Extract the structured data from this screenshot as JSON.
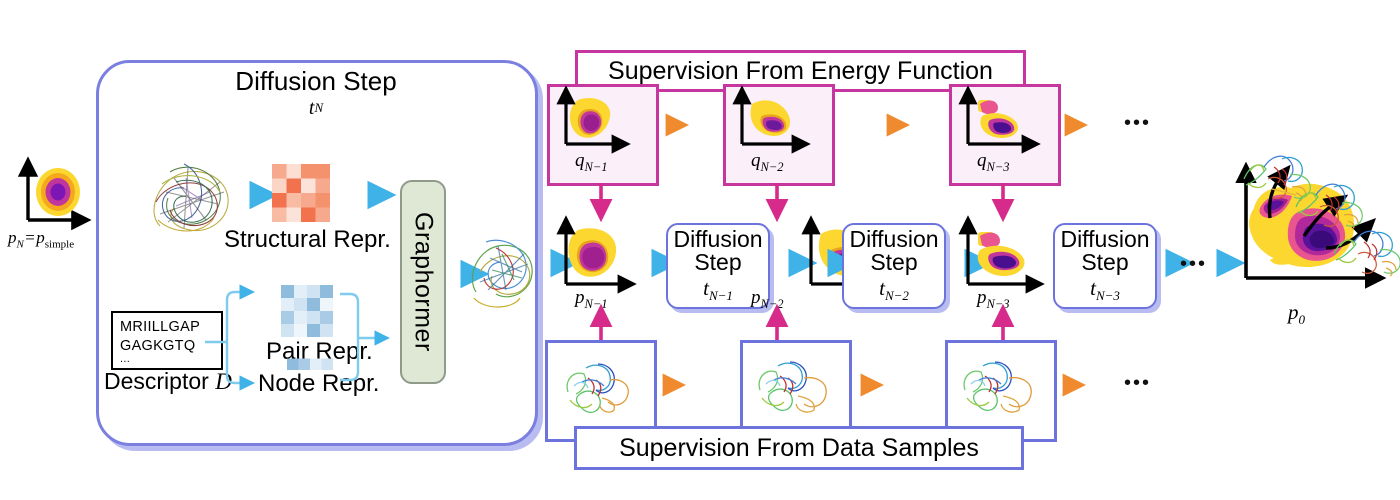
{
  "figure": {
    "kind": "diffusion-model-pipeline-diagram",
    "initial": {
      "dist_label": "p_N = p_simple",
      "dist_label_parts": [
        "p",
        "N",
        "=",
        "p",
        "simple"
      ]
    },
    "left_panel": {
      "title": "Diffusion Step",
      "subtitle": "t_N",
      "structural_repr_label": "Structural Repr.",
      "pair_repr_label": "Pair Repr.",
      "node_repr_label": "Node Repr.",
      "descriptor_label": "Descriptor",
      "descriptor_symbol": "D",
      "descriptor_lines": [
        "MRIILLGAP",
        "GAGKGTQ",
        "..."
      ],
      "encoder_label": "Graphormer"
    },
    "top_banner": "Supervision From Energy Function",
    "bottom_banner": "Supervision From Data Samples",
    "energy_cells": [
      {
        "label": "q_N-1",
        "base": "q",
        "sub": "N−1"
      },
      {
        "label": "q_N-2",
        "base": "q",
        "sub": "N−2"
      },
      {
        "label": "q_N-3",
        "base": "q",
        "sub": "N−3"
      }
    ],
    "chain_distributions": [
      {
        "label": "p_N-1",
        "base": "p",
        "sub": "N−1"
      },
      {
        "label": "p_N-2",
        "base": "p",
        "sub": "N−2"
      },
      {
        "label": "p_N-3",
        "base": "p",
        "sub": "N−3"
      }
    ],
    "diffusion_steps": [
      {
        "title": "Diffusion",
        "title2": "Step",
        "time": "t_N-1",
        "time_base": "t",
        "time_sub": "N−1"
      },
      {
        "title": "Diffusion",
        "title2": "Step",
        "time": "t_N-2",
        "time_base": "t",
        "time_sub": "N−2"
      },
      {
        "title": "Diffusion",
        "title2": "Step",
        "time": "t_N-3",
        "time_base": "t",
        "time_sub": "N−3"
      }
    ],
    "final": {
      "dist_label": "p_0",
      "base": "p",
      "sub": "0"
    },
    "ellipsis": "•••",
    "colors": {
      "panel_border": "#7a7fe0",
      "panel_shadow": "#b9bcf0",
      "energy_border": "#c7359e",
      "energy_fill": "#fbeffa",
      "data_border": "#6d73dd",
      "flow_arrow": "#4db8e8",
      "supervision_arrow": "#f08a2e",
      "inject_arrow": "#d62b8a",
      "encoder_fill": "#dfe8d4",
      "encoder_border": "#8f9a8b",
      "structural_matrix": "#f2724d",
      "pair_matrix": "#6fa8d6",
      "density_low": "#fcd730",
      "density_mid": "#c0369d",
      "density_high": "#5b129b"
    }
  }
}
